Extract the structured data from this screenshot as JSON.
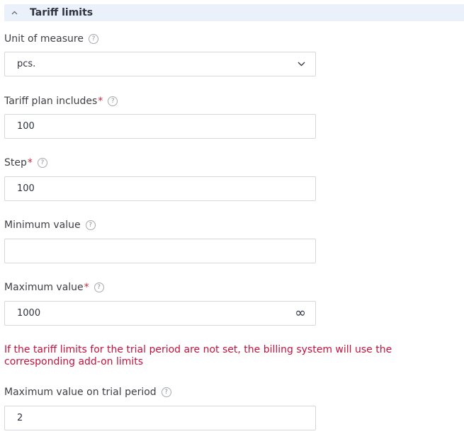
{
  "section": {
    "title": "Tariff limits"
  },
  "fields": {
    "unit_of_measure": {
      "label": "Unit of measure",
      "value": "pcs."
    },
    "tariff_plan_includes": {
      "label": "Tariff plan includes",
      "required_mark": "*",
      "value": "100"
    },
    "step": {
      "label": "Step",
      "required_mark": "*",
      "value": "100"
    },
    "minimum_value": {
      "label": "Minimum value",
      "value": ""
    },
    "maximum_value": {
      "label": "Maximum value",
      "required_mark": "*",
      "value": "1000",
      "unlimited_symbol": "∞"
    },
    "maximum_value_trial": {
      "label": "Maximum value on trial period",
      "value": "2"
    }
  },
  "help_symbol": "?",
  "warning_text": "If the tariff limits for the trial period are not set, the billing system will use the corresponding add-on limits",
  "colors": {
    "header_bg": "#eaf1fb",
    "required": "#d0243f",
    "warning": "#c4123c",
    "border": "#d4d7dc"
  },
  "icons": {
    "section_toggle": "chevron-up-icon",
    "select_toggle": "chevron-down-icon",
    "help": "help-circle-icon",
    "unlimited": "infinity-icon"
  }
}
